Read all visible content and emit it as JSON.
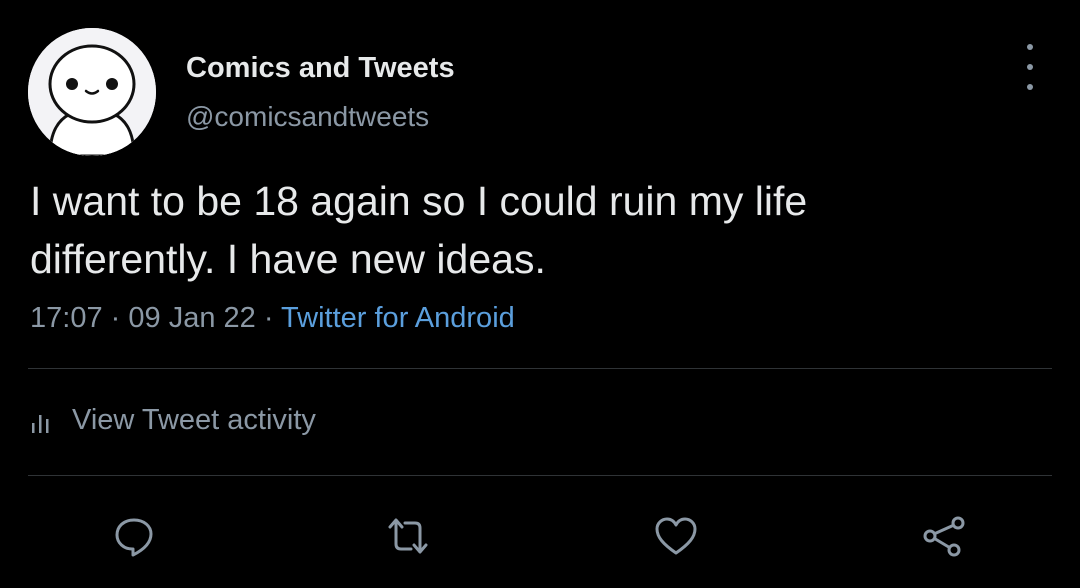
{
  "author": {
    "display_name": "Comics and Tweets",
    "handle": "@comicsandtweets",
    "avatar_icon": "cartoon-face-avatar"
  },
  "tweet": {
    "lines": [
      "I want to be 18 again so I could ruin my life",
      "differently. I have new ideas."
    ],
    "time": "17:07",
    "separator": "·",
    "date": "09 Jan 22",
    "source": "Twitter for Android"
  },
  "activity": {
    "label": "View Tweet activity",
    "icon": "bar-chart-icon"
  },
  "actions": [
    {
      "name": "reply",
      "icon": "reply-icon"
    },
    {
      "name": "retweet",
      "icon": "retweet-icon"
    },
    {
      "name": "like",
      "icon": "heart-icon"
    },
    {
      "name": "share",
      "icon": "share-icon"
    }
  ],
  "colors": {
    "background": "#000000",
    "text_primary": "#e7e9ea",
    "text_secondary": "#8b98a5",
    "link": "#5b9fdd",
    "divider": "#2f3336"
  }
}
